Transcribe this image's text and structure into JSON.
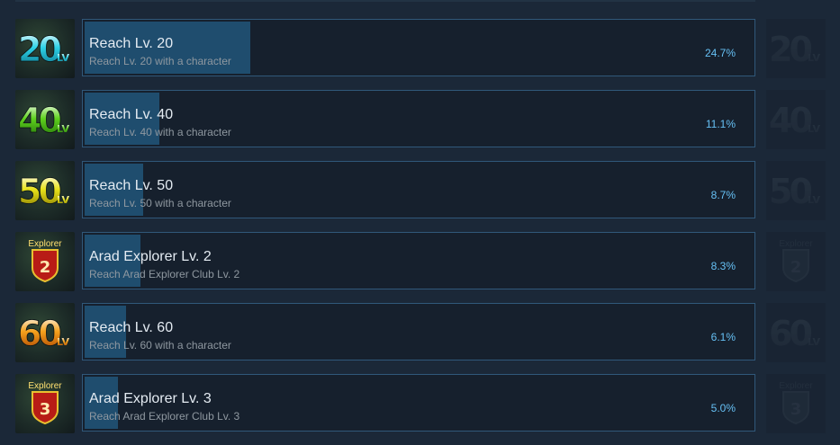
{
  "achievements": [
    {
      "title": "Reach Lv. 20",
      "desc": "Reach Lv. 20 with a character",
      "percent": "24.7%",
      "fill": 0.247,
      "icon": "level-20-icon",
      "icon_kind": "level",
      "icon_num": "20",
      "icon_sub": "LV",
      "color": "#2ed3e8",
      "color_dark": "#0b6f86"
    },
    {
      "title": "Reach Lv. 40",
      "desc": "Reach Lv. 40 with a character",
      "percent": "11.1%",
      "fill": 0.111,
      "icon": "level-40-icon",
      "icon_kind": "level",
      "icon_num": "40",
      "icon_sub": "LV",
      "color": "#5fd21e",
      "color_dark": "#1d6b08"
    },
    {
      "title": "Reach Lv. 50",
      "desc": "Reach Lv. 50 with a character",
      "percent": "8.7%",
      "fill": 0.087,
      "icon": "level-50-icon",
      "icon_kind": "level",
      "icon_num": "50",
      "icon_sub": "LV",
      "color": "#e8e21a",
      "color_dark": "#7f7300"
    },
    {
      "title": "Arad Explorer Lv. 2",
      "desc": "Reach Arad Explorer Club Lv. 2",
      "percent": "8.3%",
      "fill": 0.083,
      "icon": "explorer-2-icon",
      "icon_kind": "explorer",
      "icon_num": "2",
      "icon_sub": "Explorer",
      "color": "#e8c030",
      "color_dark": "#b81c16"
    },
    {
      "title": "Reach Lv. 60",
      "desc": "Reach Lv. 60 with a character",
      "percent": "6.1%",
      "fill": 0.061,
      "icon": "level-60-icon",
      "icon_kind": "level",
      "icon_num": "60",
      "icon_sub": "LV",
      "color": "#f5a11c",
      "color_dark": "#a33c00"
    },
    {
      "title": "Arad Explorer Lv. 3",
      "desc": "Reach Arad Explorer Club Lv. 3",
      "percent": "5.0%",
      "fill": 0.05,
      "icon": "explorer-3-icon",
      "icon_kind": "explorer",
      "icon_num": "3",
      "icon_sub": "Explorer",
      "color": "#e8c030",
      "color_dark": "#b81c16"
    }
  ],
  "colors": {
    "background": "#1b2838",
    "card_border": "#30587a",
    "bar_fill": "#1f4d6e",
    "percent_text": "#66c0f4",
    "title_text": "#e4ebf2",
    "desc_text": "#8f98a0",
    "ghost_text": "#2b3542"
  }
}
